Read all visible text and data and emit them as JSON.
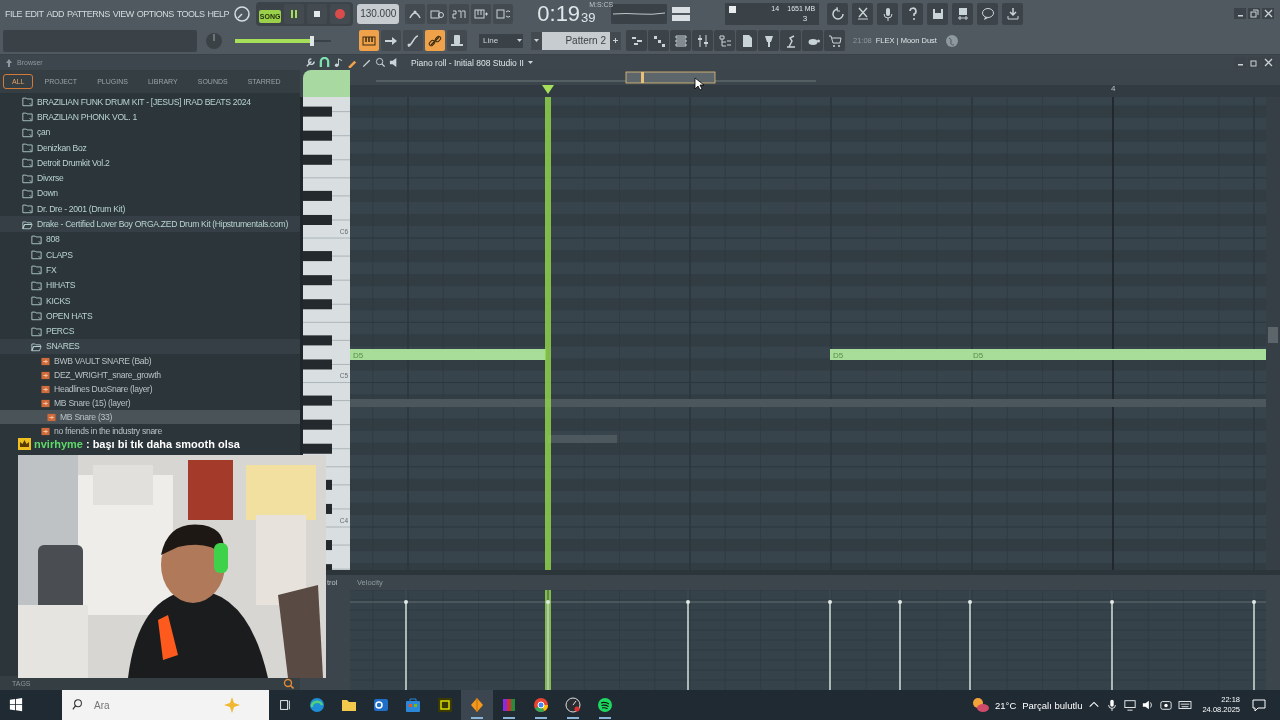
{
  "menu": [
    "FILE",
    "EDIT",
    "ADD",
    "PATTERNS",
    "VIEW",
    "OPTIONS",
    "TOOLS",
    "HELP"
  ],
  "transport": {
    "mode": "SONG",
    "song_mode": true,
    "playing": true,
    "tempo": "130.000"
  },
  "clock": {
    "time": "0:19",
    "fraction": "39",
    "format": "M:S:CS"
  },
  "monitor": {
    "cpu": "14",
    "memory": "1651 MB",
    "polyphony": "3"
  },
  "master_volume": {
    "level": 0.8
  },
  "mode_buttons": [
    {
      "kind": "keyboard",
      "on": true
    },
    {
      "kind": "arrow",
      "on": false
    },
    {
      "kind": "curve",
      "on": false
    },
    {
      "kind": "link",
      "on": true
    },
    {
      "kind": "hat",
      "on": false
    }
  ],
  "snap": "Line",
  "pattern": "Pattern 2",
  "hint": {
    "time": "21:08",
    "text": "FLEX | Moon Dust"
  },
  "browser": {
    "title": "Browser",
    "tabs": [
      {
        "label": "ALL",
        "selected": true
      },
      {
        "label": "PROJECT",
        "selected": false
      },
      {
        "label": "PLUGINS",
        "selected": false
      },
      {
        "label": "LIBRARY",
        "selected": false
      },
      {
        "label": "SOUNDS",
        "selected": false
      },
      {
        "label": "STARRED",
        "selected": false
      }
    ],
    "tree": [
      {
        "label": "BRAZILIAN FUNK DRUM KIT - [JESUS] IRAD BEATS 2024",
        "kind": "folder",
        "expanded": false,
        "selected": false
      },
      {
        "label": "BRAZILIAN PHONK VOL. 1",
        "kind": "folder",
        "expanded": false,
        "selected": false
      },
      {
        "label": "çan",
        "kind": "folder",
        "expanded": false,
        "selected": false
      },
      {
        "label": "Denizkan Boz",
        "kind": "folder",
        "expanded": false,
        "selected": false
      },
      {
        "label": "Detroit Drumkit Vol.2",
        "kind": "folder",
        "expanded": false,
        "selected": false
      },
      {
        "label": "Divxrse",
        "kind": "folder",
        "expanded": false,
        "selected": false
      },
      {
        "label": "Down",
        "kind": "folder",
        "expanded": false,
        "selected": false
      },
      {
        "label": "Dr. Dre - 2001 (Drum Kit)",
        "kind": "folder",
        "expanded": false,
        "selected": false
      },
      {
        "label": "Drake - Certified Lover Boy ORGA.ZED Drum Kit (Hipstrumentals.com)",
        "kind": "folder",
        "expanded": true,
        "selected": false,
        "children": [
          {
            "label": "808",
            "kind": "folder",
            "expanded": false,
            "selected": false
          },
          {
            "label": "CLAPS",
            "kind": "folder",
            "expanded": false,
            "selected": false
          },
          {
            "label": "FX",
            "kind": "folder",
            "expanded": false,
            "selected": false
          },
          {
            "label": "HIHATS",
            "kind": "folder",
            "expanded": false,
            "selected": false
          },
          {
            "label": "KICKS",
            "kind": "folder",
            "expanded": false,
            "selected": false
          },
          {
            "label": "OPEN HATS",
            "kind": "folder",
            "expanded": false,
            "selected": false
          },
          {
            "label": "PERCS",
            "kind": "folder",
            "expanded": false,
            "selected": false
          },
          {
            "label": "SNARES",
            "kind": "folder",
            "expanded": true,
            "selected": false,
            "children": [
              {
                "label": "BWB VAULT SNARE (Bab)",
                "kind": "file",
                "selected": false
              },
              {
                "label": "DEZ_WRIGHT_snare_growth",
                "kind": "file",
                "selected": false
              },
              {
                "label": "Headlines DuoSnare (layer)",
                "kind": "file",
                "selected": false
              },
              {
                "label": "MB Snare (15) (layer)",
                "kind": "file",
                "selected": false
              },
              {
                "label": "MB Snare (33)",
                "kind": "file",
                "selected": true
              },
              {
                "label": "no friends in the industry snare",
                "kind": "file",
                "selected": false
              }
            ]
          }
        ]
      }
    ]
  },
  "chat": {
    "user": "nvirhyme",
    "message": ": başı bi tık daha smooth olsa"
  },
  "webcam": {
    "kind": "picture"
  },
  "tags_label": "TAGS",
  "piano_roll": {
    "title": "Piano roll - Initial 808 Studio II",
    "bar_marker": "4",
    "key_labels": [
      "C6",
      "C5",
      "C4"
    ],
    "notes": [
      {
        "label": "D5"
      },
      {
        "label": "D5"
      },
      {
        "label": "D5"
      }
    ],
    "control_label": "trol",
    "control_target": "Velocity",
    "velocity": [
      {
        "level": 0.88
      },
      {
        "level": 0.88
      },
      {
        "level": 0.88
      },
      {
        "level": 0.88
      },
      {
        "level": 0.88
      },
      {
        "level": 0.88
      },
      {
        "level": 0.88
      },
      {
        "level": 0.88
      }
    ]
  },
  "taskbar": {
    "search_placeholder": "Ara",
    "apps": [
      {
        "kind": "edge",
        "running": false,
        "active": false
      },
      {
        "kind": "explorer",
        "running": false,
        "active": false
      },
      {
        "kind": "outlook",
        "running": false,
        "active": false
      },
      {
        "kind": "store",
        "running": false,
        "active": false
      },
      {
        "kind": "fireworks",
        "running": false,
        "active": false
      },
      {
        "kind": "flstudio",
        "running": true,
        "active": true
      },
      {
        "kind": "winrar",
        "running": true,
        "active": false
      },
      {
        "kind": "chrome",
        "running": true,
        "active": false
      },
      {
        "kind": "recorder",
        "running": true,
        "active": false
      },
      {
        "kind": "spotify",
        "running": true,
        "active": false
      }
    ],
    "weather": {
      "temp": "21°C",
      "text": "Parçalı bulutlu"
    },
    "time": "22:18",
    "date": "24.08.2025"
  }
}
